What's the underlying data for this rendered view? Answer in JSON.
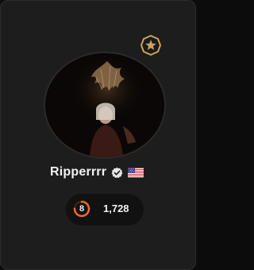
{
  "profile": {
    "username": "Ripperrrr",
    "verified_icon": "verified-check-icon",
    "country_flag": "us-flag-icon",
    "rank_badge_icon": "star-badge-icon",
    "level": "8",
    "level_progress": 0.75,
    "points": "1,728"
  },
  "colors": {
    "card_background": "#1d1d1d",
    "page_background": "#0c0c0c",
    "accent_orange": "#f26a1b",
    "badge_gold": "#c9a45c",
    "pill_background": "#111111"
  }
}
